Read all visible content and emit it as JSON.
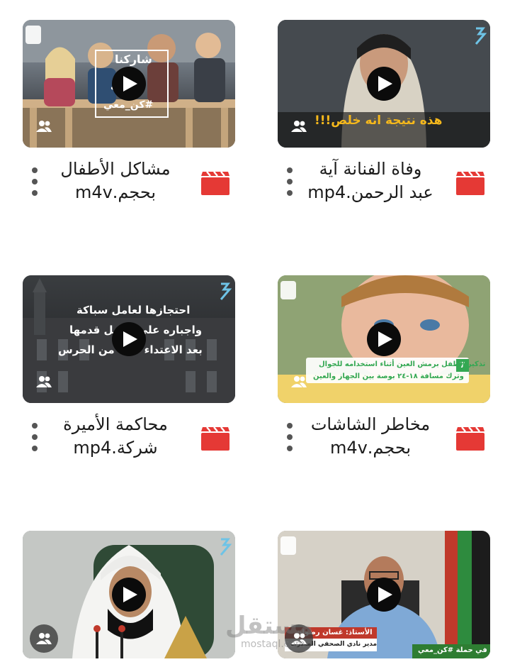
{
  "videos": [
    {
      "title_line1": "مشاكل الأطفال",
      "title_line2": "بحجم.m4v",
      "overlay_lines": [
        "شاركنا",
        "ف",
        "#كن_معي"
      ]
    },
    {
      "title_line1": "وفاة الفنانة آية",
      "title_line2": "عبد الرحمن.mp4",
      "overlay_lines": [
        "هذه نتيجة انه خلص!!!"
      ]
    },
    {
      "title_line1": "محاكمة الأميرة",
      "title_line2": "شركة.mp4",
      "overlay_lines": [
        "احتجازها لعامل سباكة",
        "واجباره علي تقبيل قدمها",
        "بعد الاعتداء عليه من الحرس"
      ]
    },
    {
      "title_line1": "مخاطر الشاشات",
      "title_line2": "بحجم.m4v",
      "overlay_lines": [
        "تذكير الطفل برمش العين أثناء استخدامه للجوال",
        "وترك مسافة ١٨-٢٤ بوصة بين الجهاز والعين"
      ],
      "overlay_badge": "7"
    },
    {
      "title_line1": "",
      "title_line2": "",
      "overlay_lines": []
    },
    {
      "title_line1": "",
      "title_line2": "",
      "overlay_lines": [
        "الأستاذ: غسان رضوان",
        "مدير نادي الصحفي المغترب",
        "شاركنا في حملة #كن_معي"
      ]
    }
  ],
  "watermark": {
    "main": "مستقل",
    "sub": "mostaql.com"
  },
  "colors": {
    "clapper": "#e53935",
    "accent_yellow": "#f5b81c",
    "accent_green": "#34a853"
  },
  "icons": {
    "play": "play-icon",
    "group": "group-icon",
    "more": "more-vert-icon",
    "video_file": "video-clapper-icon"
  }
}
